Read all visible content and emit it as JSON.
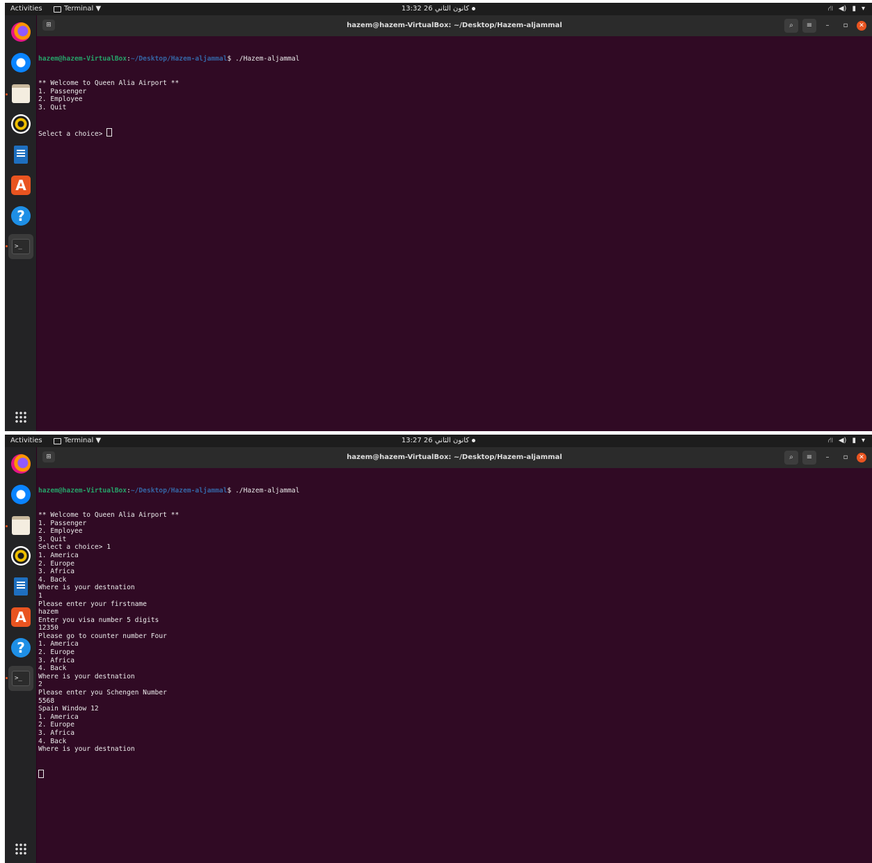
{
  "topbar": {
    "activities": "Activities",
    "app_menu": "Terminal ▼",
    "tray": [
      "⛙",
      "◀)",
      "▮",
      "▾"
    ]
  },
  "dock": {
    "items": [
      {
        "name": "firefox-icon"
      },
      {
        "name": "thunderbird-icon"
      },
      {
        "name": "files-icon"
      },
      {
        "name": "rhythmbox-icon"
      },
      {
        "name": "writer-icon"
      },
      {
        "name": "software-store-icon",
        "glyph": "A"
      },
      {
        "name": "help-icon",
        "glyph": "?"
      },
      {
        "name": "terminal-icon",
        "glyph": ">_"
      }
    ]
  },
  "window": {
    "title": "hazem@hazem-VirtualBox: ~/Desktop/Hazem-aljammal",
    "new_tab_glyph": "⊞",
    "search_glyph": "⌕",
    "menu_glyph": "≡",
    "minimize_glyph": "–",
    "maximize_glyph": "▫",
    "close_glyph": "✕"
  },
  "prompt": {
    "user_host": "hazem@hazem-VirtualBox",
    "colon": ":",
    "path": "~/Desktop/Hazem-aljammal",
    "command": "$ ./Hazem-aljammal"
  },
  "screens": [
    {
      "clock": "كانون الثاني 26  13:32",
      "output": [
        "** Welcome to Queen Alia Airport **",
        "1. Passenger",
        "2. Employee",
        "3. Quit"
      ],
      "final_prompt": "Select a choice> "
    },
    {
      "clock": "كانون الثاني 26  13:27",
      "output": [
        "** Welcome to Queen Alia Airport **",
        "1. Passenger",
        "2. Employee",
        "3. Quit",
        "Select a choice> 1",
        "1. America",
        "2. Europe",
        "3. Africa",
        "4. Back",
        "Where is your destnation",
        "1",
        "Please enter your firstname",
        "hazem",
        "Enter you visa number 5 digits",
        "12350",
        "Please go to counter number Four",
        "1. America",
        "2. Europe",
        "3. Africa",
        "4. Back",
        "Where is your destnation",
        "2",
        "Please enter you Schengen Number",
        "5568",
        "Spain Window 12",
        "1. America",
        "2. Europe",
        "3. Africa",
        "4. Back",
        "Where is your destnation"
      ],
      "final_prompt": ""
    }
  ]
}
